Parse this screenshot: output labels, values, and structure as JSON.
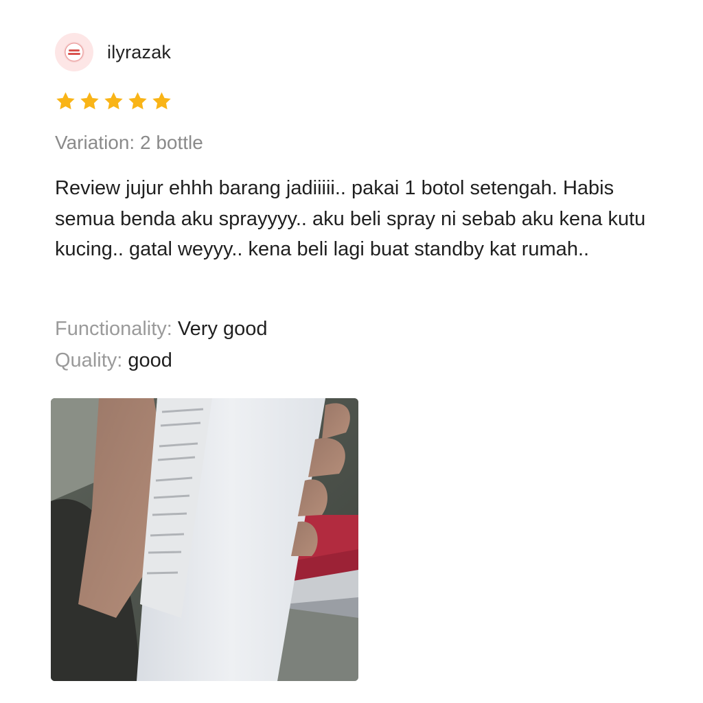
{
  "review": {
    "username": "ilyrazak",
    "avatar_icon": "profile-avatar-icon",
    "rating": 5,
    "rating_max": 5,
    "star_color": "#F9B417",
    "variation": "Variation: 2 bottle",
    "text": "Review jujur ehhh barang jadiiiii.. pakai 1 botol setengah. Habis semua benda aku sprayyyy.. aku beli spray ni sebab aku kena kutu kucing.. gatal weyyy.. kena beli lagi buat standby kat rumah..",
    "attributes": [
      {
        "label": "Functionality:",
        "value": "Very good"
      },
      {
        "label": "Quality:",
        "value": "good"
      }
    ],
    "photo": {
      "icon": "review-photo-bottle-in-hand"
    }
  }
}
